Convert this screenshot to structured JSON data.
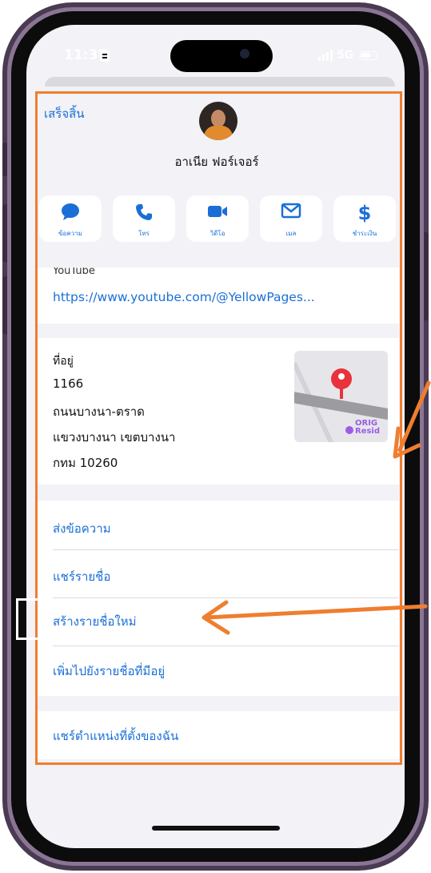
{
  "status_bar": {
    "time": "11:37",
    "network": "5G"
  },
  "header": {
    "done_label": "เสร็จสิ้น",
    "contact_name": "อาเนีย ฟอร์เจอร์"
  },
  "actions": [
    {
      "label": "ข้อความ",
      "icon": "message-bubble-icon"
    },
    {
      "label": "โทร",
      "icon": "phone-icon"
    },
    {
      "label": "วิดีโอ",
      "icon": "video-camera-icon"
    },
    {
      "label": "เมล",
      "icon": "mail-envelope-icon"
    },
    {
      "label": "ชำระเงิน",
      "icon": "dollar-icon"
    }
  ],
  "url_card": {
    "label": "YouTube",
    "url": "https://www.youtube.com/@YellowPages..."
  },
  "address_card": {
    "label": "ที่อยู่",
    "lines": [
      "1166",
      "ถนนบางนา-ตราด",
      "แขวงบางนา เขตบางนา",
      "กทม 10260"
    ],
    "map_brand": "ORIG Resid"
  },
  "menu": {
    "items": [
      "ส่งข้อความ",
      "แชร์รายชื่อ",
      "สร้างรายชื่อใหม่",
      "เพิ่มไปยังรายชื่อที่มีอยู่"
    ],
    "share_location": "แชร์ตำแหน่งที่ตั้งของฉัน"
  },
  "colors": {
    "accent": "#1a6fd6",
    "annotation": "#ef7e2f",
    "phone_frame": "#4a3a52"
  }
}
